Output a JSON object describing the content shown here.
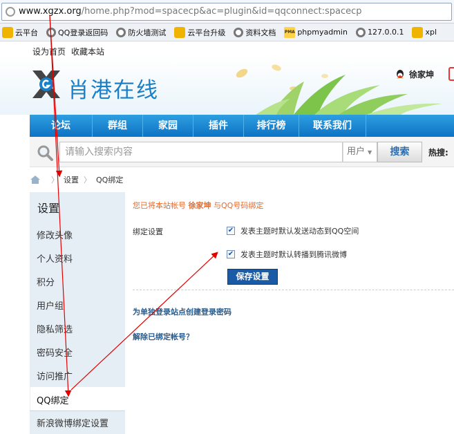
{
  "browser": {
    "url_domain": "www.xgzx.org",
    "url_path": "/home.php?mod=spacecp&ac=plugin&id=qqconnect:spacecp",
    "bookmarks": [
      {
        "label": "云平台",
        "icon": "folder-icon"
      },
      {
        "label": "QQ登录返回码",
        "icon": "globe-icon"
      },
      {
        "label": "防火墙测试",
        "icon": "globe-icon"
      },
      {
        "label": "云平台升级",
        "icon": "folder-icon"
      },
      {
        "label": "资料文档",
        "icon": "globe-icon"
      },
      {
        "label": "phpmyadmin",
        "icon": "pma-icon"
      },
      {
        "label": "127.0.0.1",
        "icon": "globe-icon"
      },
      {
        "label": "xpl",
        "icon": "folder-icon"
      }
    ]
  },
  "site": {
    "top_links": [
      "设为首页",
      "收藏本站"
    ],
    "logo_text": "肖港在线",
    "username": "徐家坤",
    "nav": [
      "论坛",
      "群组",
      "家园",
      "插件",
      "排行榜",
      "联系我们"
    ],
    "search": {
      "placeholder": "请输入搜索内容",
      "type": "用户",
      "button": "搜索",
      "hot_label": "热搜:"
    },
    "breadcrumb": [
      "设置",
      "QQ绑定"
    ]
  },
  "sidebar": {
    "title": "设置",
    "items": [
      "修改头像",
      "个人资料",
      "积分",
      "用户组",
      "隐私筛选",
      "密码安全",
      "访问推广",
      "QQ绑定",
      "新浪微博绑定设置"
    ],
    "active": "QQ绑定"
  },
  "content": {
    "bind_prefix": "您已将本站帐号",
    "bind_user": "徐家坤",
    "bind_suffix": "与QQ号码绑定",
    "settings_label": "绑定设置",
    "options": [
      {
        "label": "发表主题时默认发送动态到QQ空间",
        "checked": true
      },
      {
        "label": "发表主题时默认转播到腾讯微博",
        "checked": true
      }
    ],
    "save_button": "保存设置",
    "links": [
      "为单独登录站点创建登录密码",
      "解除已绑定帐号？"
    ]
  },
  "colors": {
    "nav_blue": "#1a86d4",
    "accent_orange": "#e36a2d",
    "save_blue": "#1b5ba6",
    "annotation_red": "#e00000"
  }
}
